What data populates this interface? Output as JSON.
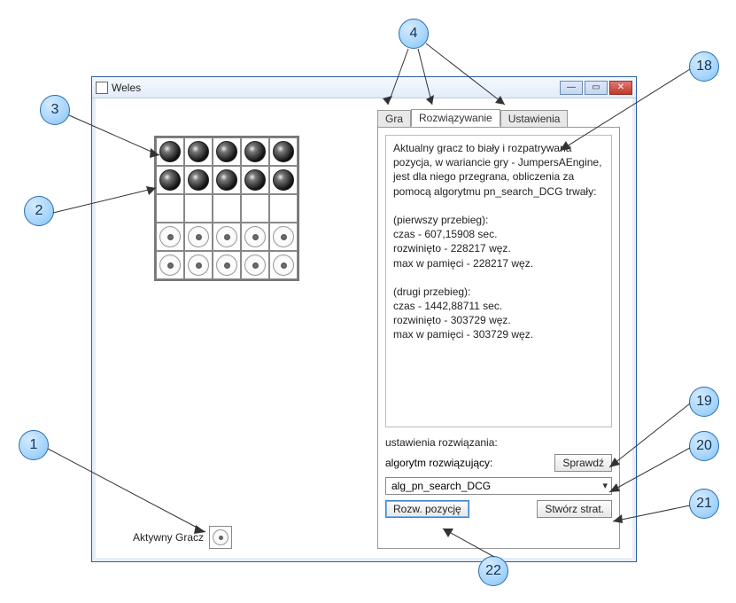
{
  "window": {
    "title": "Weles"
  },
  "board": {
    "rows": [
      [
        "black",
        "black",
        "black",
        "black",
        "black"
      ],
      [
        "black",
        "black",
        "black",
        "black",
        "black"
      ],
      [
        "empty",
        "empty",
        "empty",
        "empty",
        "empty"
      ],
      [
        "white",
        "white",
        "white",
        "white",
        "white"
      ],
      [
        "white",
        "white",
        "white",
        "white",
        "white"
      ]
    ]
  },
  "active_player": {
    "label": "Aktywny Gracz",
    "piece": "white"
  },
  "tabs": {
    "gra": "Gra",
    "rozw": "Rozwiązywanie",
    "ust": "Ustawienia",
    "active": "rozw"
  },
  "panel": {
    "result_text": "Aktualny gracz to biały i rozpatrywana pozycja, w wariancie gry - JumpersAEngine, jest dla niego przegrana, obliczenia za pomocą algorytmu pn_search_DCG trwały:\n\n(pierwszy przebieg):\nczas - 607,15908 sec.\nrozwinięto - 228217 węz.\nmax w pamięci - 228217 węz.\n\n(drugi przebieg):\nczas - 1442,88711 sec.\nrozwinięto - 303729 węz.\nmax w pamięci - 303729 węz.",
    "settings_label": "ustawienia rozwiązania:",
    "alg_label": "algorytm rozwiązujący:",
    "check_btn": "Sprawdź",
    "alg_selected": "alg_pn_search_DCG",
    "solve_btn": "Rozw. pozycję",
    "strat_btn": "Stwórz strat."
  },
  "callouts": {
    "c1": "1",
    "c2": "2",
    "c3": "3",
    "c4": "4",
    "c18": "18",
    "c19": "19",
    "c20": "20",
    "c21": "21",
    "c22": "22"
  }
}
